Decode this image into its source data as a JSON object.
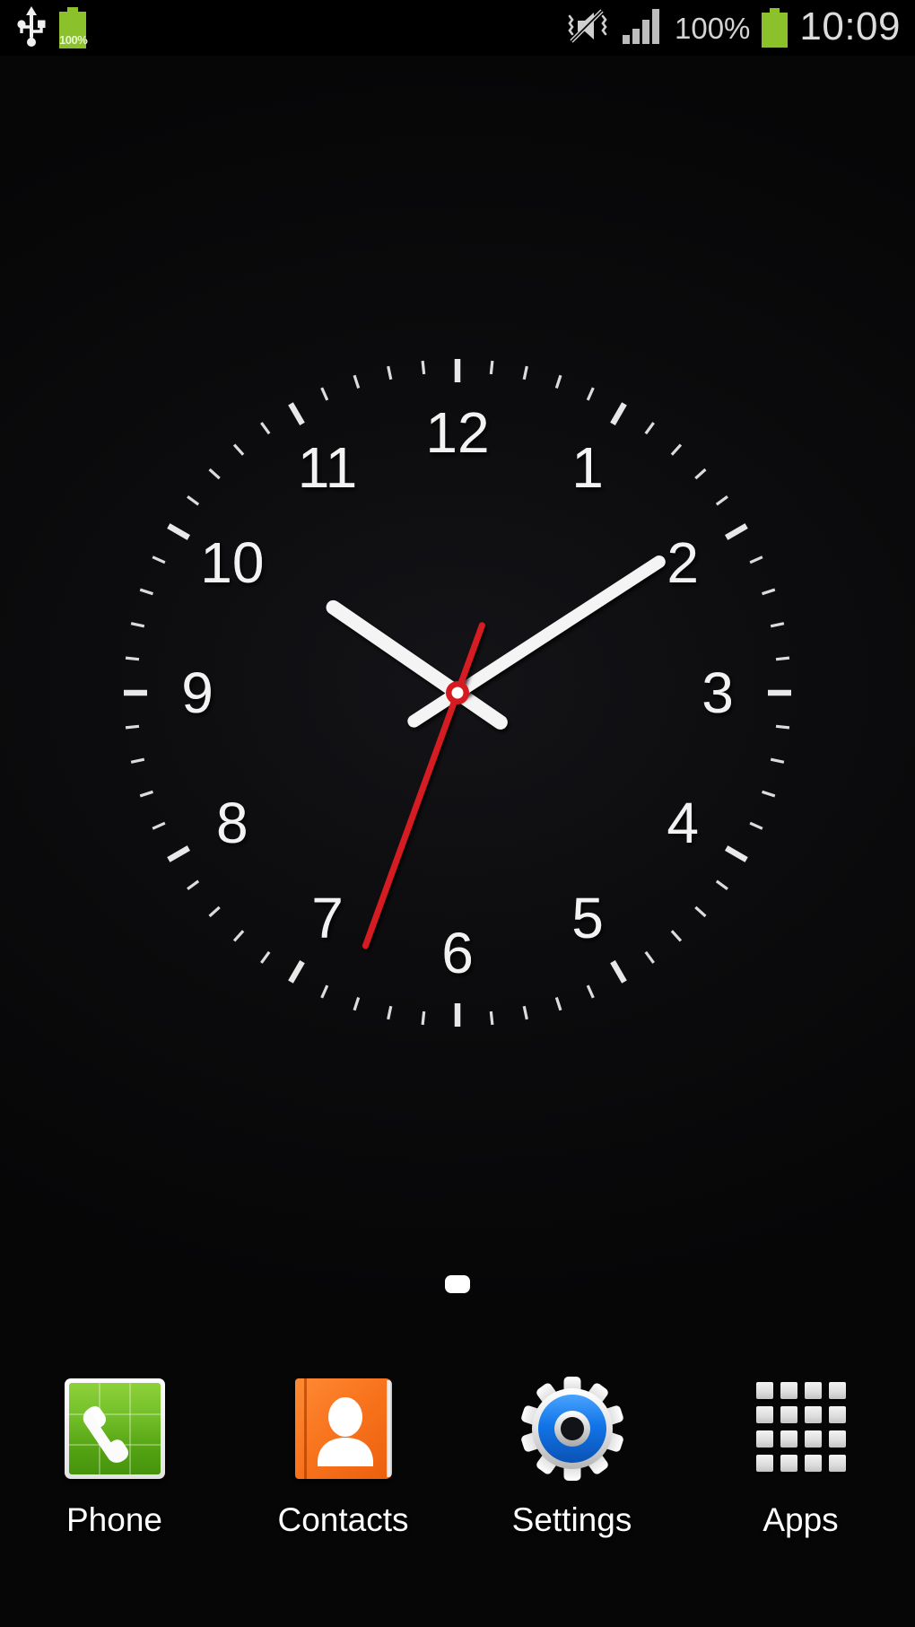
{
  "status_bar": {
    "left_icons": [
      {
        "name": "usb-icon",
        "label": "USB"
      },
      {
        "name": "battery-charging-icon",
        "label": "100%"
      }
    ],
    "battery_inline_percent": "100%",
    "right_icons": [
      {
        "name": "sound-mute-vibrate-icon",
        "label": "Mute"
      },
      {
        "name": "signal-bars-icon",
        "label": "Signal"
      }
    ],
    "battery_percent_text": "100%",
    "clock": "10:09",
    "signal_bars_total": 4,
    "signal_bars_filled": 4,
    "battery_color": "#8bc22c",
    "text_color": "#d4d4d4"
  },
  "clock_widget": {
    "name": "analog-clock-widget",
    "numerals": [
      "12",
      "1",
      "2",
      "3",
      "4",
      "5",
      "6",
      "7",
      "8",
      "9",
      "10",
      "11"
    ],
    "hour": 10,
    "minute": 9,
    "second": 33,
    "hour_hand_angle_deg": 304.5,
    "minute_hand_angle_deg": 57,
    "second_hand_angle_deg": 200,
    "hand_colors": {
      "hour": "#f4f4f4",
      "minute": "#f4f4f4",
      "second": "#d51a20",
      "hub_ring": "#d51a20",
      "hub_center": "#ffffff"
    },
    "tick_color": "#e8e8e8",
    "numeral_color": "#f2f2f2"
  },
  "page_indicator": {
    "total_pages": 1,
    "current_page": 1,
    "active_color": "#ffffff"
  },
  "dock": {
    "items": [
      {
        "name": "dock-item-phone",
        "label": "Phone",
        "icon": "phone-icon"
      },
      {
        "name": "dock-item-contacts",
        "label": "Contacts",
        "icon": "contacts-icon"
      },
      {
        "name": "dock-item-settings",
        "label": "Settings",
        "icon": "settings-gear-icon"
      },
      {
        "name": "dock-item-apps",
        "label": "Apps",
        "icon": "apps-grid-icon"
      }
    ]
  },
  "wallpaper": {
    "background_color": "#08080a"
  }
}
